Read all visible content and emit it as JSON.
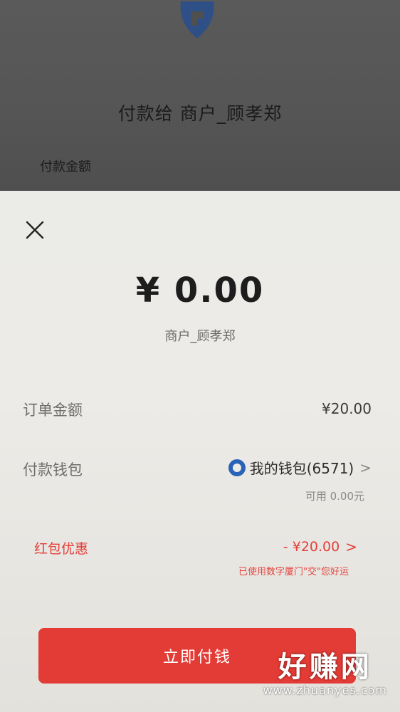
{
  "background": {
    "pay_to": "付款给 商户_顾孝郑",
    "amount_caption": "付款金额"
  },
  "sheet": {
    "amount": "¥ 0.00",
    "merchant": "商户_顾孝郑",
    "order_label": "订单金额",
    "order_value": "¥20.00",
    "wallet_label": "付款钱包",
    "wallet_value": "我的钱包(6571)",
    "available": "可用 0.00元",
    "redpacket_label": "红包优惠",
    "redpacket_value": "- ¥20.00",
    "redpacket_note": "已使用数字厦门\"交\"您好运",
    "pay_button": "立即付钱"
  },
  "watermark": {
    "title": "好赚网",
    "url": "www.zhuanyes.com"
  },
  "colors": {
    "accent_red": "#e33b35",
    "wallet_blue": "#2a62b8"
  },
  "icons": [
    "bank-logo-icon",
    "close-icon",
    "wallet-icon",
    "chevron-right-icon"
  ]
}
